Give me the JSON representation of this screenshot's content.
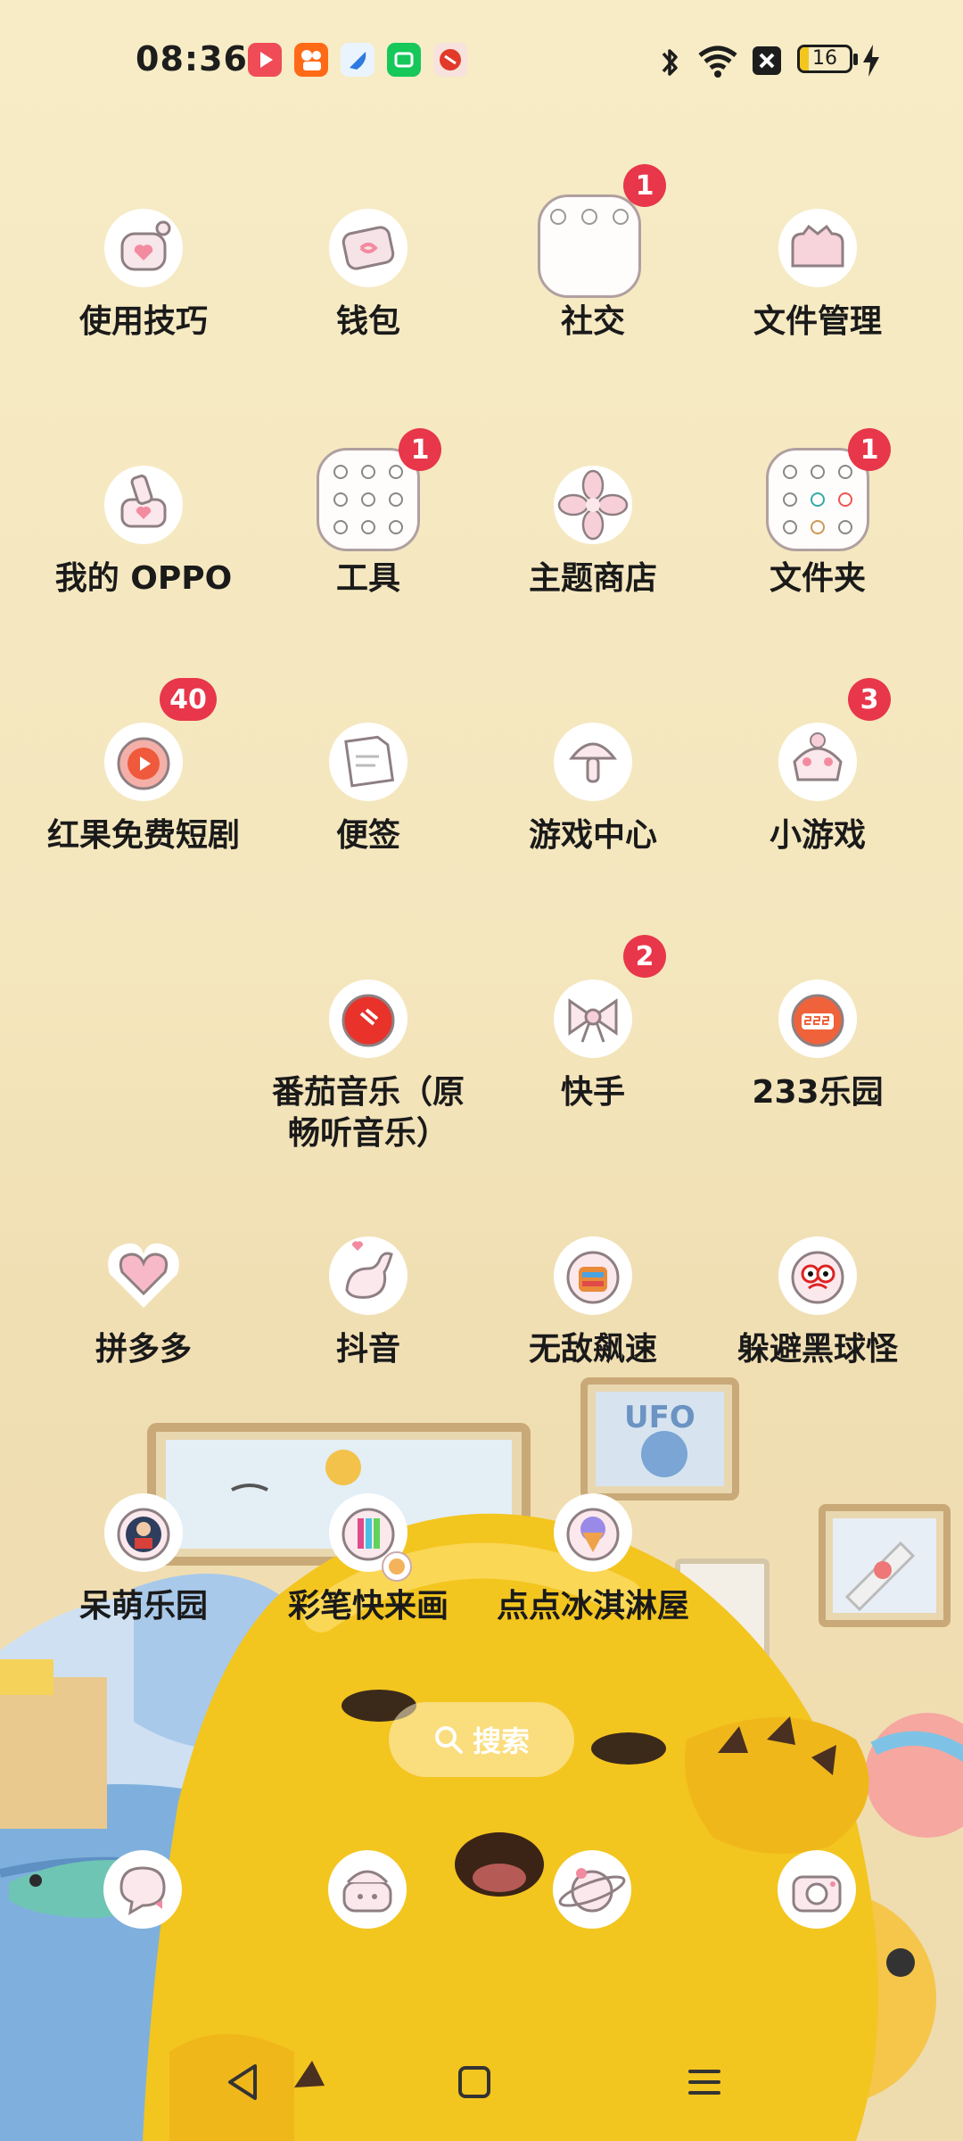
{
  "status_bar": {
    "time": "08:36",
    "battery": "16",
    "notification_icons": [
      "video-app-icon",
      "kuaishou-app-icon",
      "browser-app-icon",
      "iqiyi-app-icon",
      "fanqie-app-icon"
    ]
  },
  "apps": [
    {
      "name": "使用技巧",
      "badge": ""
    },
    {
      "name": "钱包",
      "badge": ""
    },
    {
      "name": "社交",
      "badge": "1"
    },
    {
      "name": "文件管理",
      "badge": ""
    },
    {
      "name": "我的 OPPO",
      "badge": ""
    },
    {
      "name": "工具",
      "badge": "1"
    },
    {
      "name": "主题商店",
      "badge": ""
    },
    {
      "name": "文件夹",
      "badge": "1"
    },
    {
      "name": "红果免费短剧",
      "badge": "40"
    },
    {
      "name": "便签",
      "badge": ""
    },
    {
      "name": "游戏中心",
      "badge": ""
    },
    {
      "name": "小游戏",
      "badge": "3"
    },
    {
      "name": "番茄音乐（原\n畅听音乐）",
      "badge": ""
    },
    {
      "name": "快手",
      "badge": "2"
    },
    {
      "name": "233乐园",
      "badge": ""
    },
    {
      "name": "拼多多",
      "badge": ""
    },
    {
      "name": "抖音",
      "badge": ""
    },
    {
      "name": "无敌飙速",
      "badge": ""
    },
    {
      "name": "躲避黑球怪",
      "badge": ""
    },
    {
      "name": "呆萌乐园",
      "badge": ""
    },
    {
      "name": "彩笔快来画",
      "badge": ""
    },
    {
      "name": "点点冰淇淋屋",
      "badge": ""
    }
  ],
  "search": {
    "label": "搜索"
  },
  "dock": [
    "messages-icon",
    "phone-icon",
    "browser-icon",
    "camera-icon"
  ],
  "wallpaper": {
    "frame_text": "UFO"
  },
  "colors": {
    "badge": "#e8364a",
    "icon_bg": "#ffffff",
    "accent_pink": "#f4b7c4"
  }
}
